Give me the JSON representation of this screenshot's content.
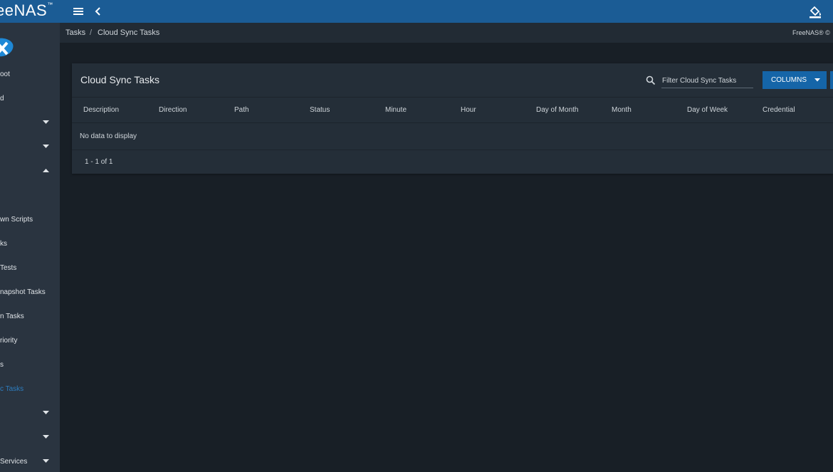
{
  "app": {
    "brand": "eeNAS",
    "brand_mark": "™"
  },
  "icons": {
    "menu": "menu-icon",
    "back": "chevron-left-icon",
    "theme": "paint-bucket-icon",
    "search": "search-icon",
    "caret_down": "chevron-down-icon",
    "caret_up": "chevron-up-icon"
  },
  "sidebar": {
    "items": [
      {
        "label": "oot"
      },
      {
        "label": "d"
      },
      {
        "label": ""
      },
      {
        "label": ""
      },
      {
        "label": ""
      },
      {
        "label": "wn Scripts"
      },
      {
        "label": "ks"
      },
      {
        "label": " Tests"
      },
      {
        "label": "napshot Tasks"
      },
      {
        "label": "n Tasks"
      },
      {
        "label": "riority"
      },
      {
        "label": "s"
      },
      {
        "label": "c Tasks"
      },
      {
        "label": ""
      },
      {
        "label": ""
      },
      {
        "label": "Services"
      }
    ]
  },
  "breadcrumb": {
    "parent": "Tasks",
    "separator": "/",
    "current": "Cloud Sync Tasks"
  },
  "copyright": "FreeNAS® ©",
  "card": {
    "title": "Cloud Sync Tasks",
    "filter_placeholder": "Filter Cloud Sync Tasks",
    "columns_button": "COLUMNS",
    "columns": [
      "Description",
      "Direction",
      "Path",
      "Status",
      "Minute",
      "Hour",
      "Day of Month",
      "Month",
      "Day of Week",
      "Credential"
    ],
    "empty_text": "No data to display",
    "pagination": "1 - 1 of 1"
  },
  "colors": {
    "topbar": "#1b5c95",
    "sidebar": "#2a3440",
    "background": "#181f26",
    "card": "#242e38",
    "accent": "#1565a8",
    "active_nav": "#2d7dbf"
  }
}
